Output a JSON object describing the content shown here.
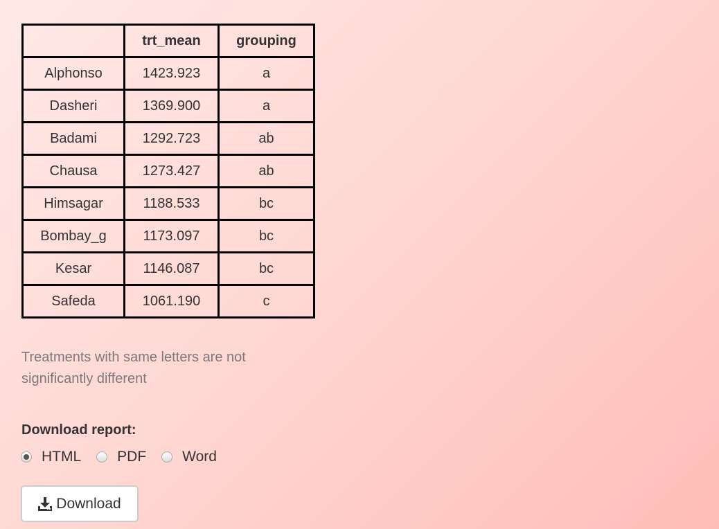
{
  "table": {
    "headers": [
      "",
      "trt_mean",
      "grouping"
    ],
    "rows": [
      {
        "treatment": "Alphonso",
        "trt_mean": "1423.923",
        "grouping": "a"
      },
      {
        "treatment": "Dasheri",
        "trt_mean": "1369.900",
        "grouping": "a"
      },
      {
        "treatment": "Badami",
        "trt_mean": "1292.723",
        "grouping": "ab"
      },
      {
        "treatment": "Chausa",
        "trt_mean": "1273.427",
        "grouping": "ab"
      },
      {
        "treatment": "Himsagar",
        "trt_mean": "1188.533",
        "grouping": "bc"
      },
      {
        "treatment": "Bombay_g",
        "trt_mean": "1173.097",
        "grouping": "bc"
      },
      {
        "treatment": "Kesar",
        "trt_mean": "1146.087",
        "grouping": "bc"
      },
      {
        "treatment": "Safeda",
        "trt_mean": "1061.190",
        "grouping": "c"
      }
    ]
  },
  "note": "Treatments with same letters are not significantly different",
  "download": {
    "label": "Download report:",
    "options": [
      {
        "label": "HTML",
        "checked": true
      },
      {
        "label": "PDF",
        "checked": false
      },
      {
        "label": "Word",
        "checked": false
      }
    ],
    "button_label": "Download",
    "button_icon": "download-icon"
  }
}
